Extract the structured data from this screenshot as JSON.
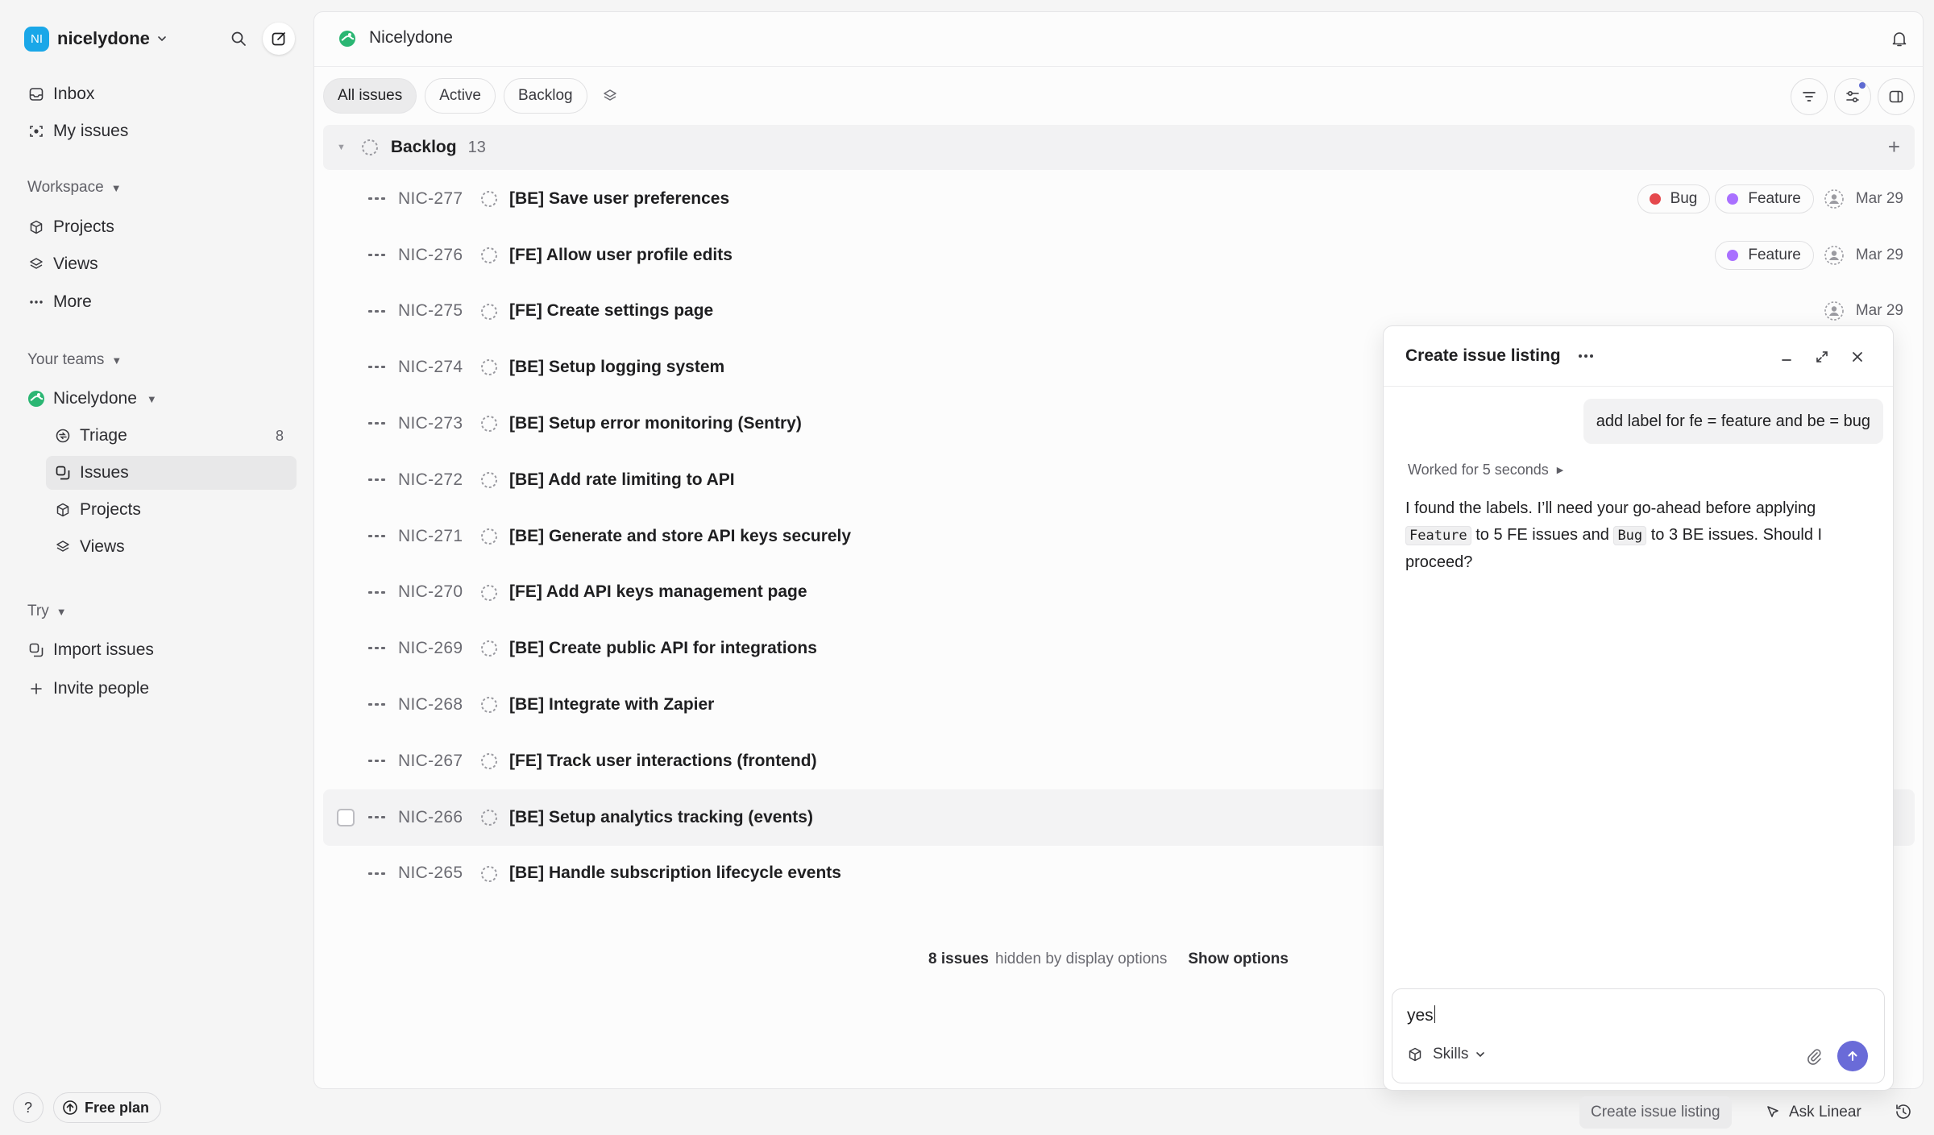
{
  "workspace": {
    "initials": "NI",
    "name": "nicelydone"
  },
  "sidebar": {
    "top_items": [
      {
        "label": "Inbox",
        "icon": "inbox-icon"
      },
      {
        "label": "My issues",
        "icon": "target-icon"
      }
    ],
    "workspace_section": {
      "title": "Workspace",
      "items": [
        {
          "label": "Projects",
          "icon": "cube-icon"
        },
        {
          "label": "Views",
          "icon": "layers-icon"
        },
        {
          "label": "More",
          "icon": "more-dots-icon"
        }
      ]
    },
    "teams_section": {
      "title": "Your teams",
      "team_name": "Nicelydone",
      "items": [
        {
          "label": "Triage",
          "icon": "triage-icon",
          "count": "8"
        },
        {
          "label": "Issues",
          "icon": "issues-icon",
          "active": true
        },
        {
          "label": "Projects",
          "icon": "cube-icon"
        },
        {
          "label": "Views",
          "icon": "layers-icon"
        }
      ]
    },
    "try_section": {
      "title": "Try",
      "items": [
        {
          "label": "Import issues",
          "icon": "import-icon"
        },
        {
          "label": "Invite people",
          "icon": "plus-icon"
        }
      ]
    },
    "help_label": "?",
    "plan_label": "Free plan"
  },
  "header": {
    "title": "Nicelydone"
  },
  "tabs": [
    {
      "label": "All issues",
      "active": true
    },
    {
      "label": "Active"
    },
    {
      "label": "Backlog"
    }
  ],
  "group": {
    "name": "Backlog",
    "count": "13",
    "add": "+"
  },
  "issues": [
    {
      "id": "NIC-277",
      "title": "[BE] Save user preferences",
      "labels": [
        {
          "name": "Bug",
          "color": "#e5484d"
        },
        {
          "name": "Feature",
          "color": "#a970ff"
        }
      ],
      "date": "Mar 29"
    },
    {
      "id": "NIC-276",
      "title": "[FE] Allow user profile edits",
      "labels": [
        {
          "name": "Feature",
          "color": "#a970ff"
        }
      ],
      "date": "Mar 29"
    },
    {
      "id": "NIC-275",
      "title": "[FE] Create settings page",
      "labels": [],
      "date": "Mar 29"
    },
    {
      "id": "NIC-274",
      "title": "[BE] Setup logging system",
      "labels": [],
      "date": ""
    },
    {
      "id": "NIC-273",
      "title": "[BE] Setup error monitoring (Sentry)",
      "labels": [],
      "date": ""
    },
    {
      "id": "NIC-272",
      "title": "[BE] Add rate limiting to API",
      "labels": [],
      "date": ""
    },
    {
      "id": "NIC-271",
      "title": "[BE] Generate and store API keys securely",
      "labels": [],
      "date": ""
    },
    {
      "id": "NIC-270",
      "title": "[FE] Add API keys management page",
      "labels": [],
      "date": ""
    },
    {
      "id": "NIC-269",
      "title": "[BE] Create public API for integrations",
      "labels": [],
      "date": ""
    },
    {
      "id": "NIC-268",
      "title": "[BE] Integrate with Zapier",
      "labels": [],
      "date": ""
    },
    {
      "id": "NIC-267",
      "title": "[FE] Track user interactions (frontend)",
      "labels": [],
      "date": ""
    },
    {
      "id": "NIC-266",
      "title": "[BE] Setup analytics tracking (events)",
      "labels": [],
      "date": "",
      "hover": true
    },
    {
      "id": "NIC-265",
      "title": "[BE] Handle subscription lifecycle events",
      "labels": [],
      "date": ""
    }
  ],
  "footer": {
    "count": "8 issues",
    "text": "hidden by display options",
    "action": "Show options"
  },
  "chat": {
    "title": "Create issue listing",
    "user_message": "add label for fe = feature and be = bug",
    "worked": "Worked for 5 seconds",
    "reply": {
      "p1": "I found the labels. I’ll need your go-ahead before applying",
      "code1": "Feature",
      "p2": "to 5 FE issues and",
      "code2": "Bug",
      "p3": "to 3 BE issues. Should I proceed?"
    },
    "input_value": "yes",
    "skills_label": "Skills"
  },
  "bottom_bar": {
    "create_label": "Create issue listing",
    "ask_label": "Ask Linear"
  },
  "colors": {
    "accent": "#5e6ad2",
    "send": "#6a6bd8",
    "workspace_avatar": "#1aa7e8",
    "team_icon": "#2bb673"
  }
}
